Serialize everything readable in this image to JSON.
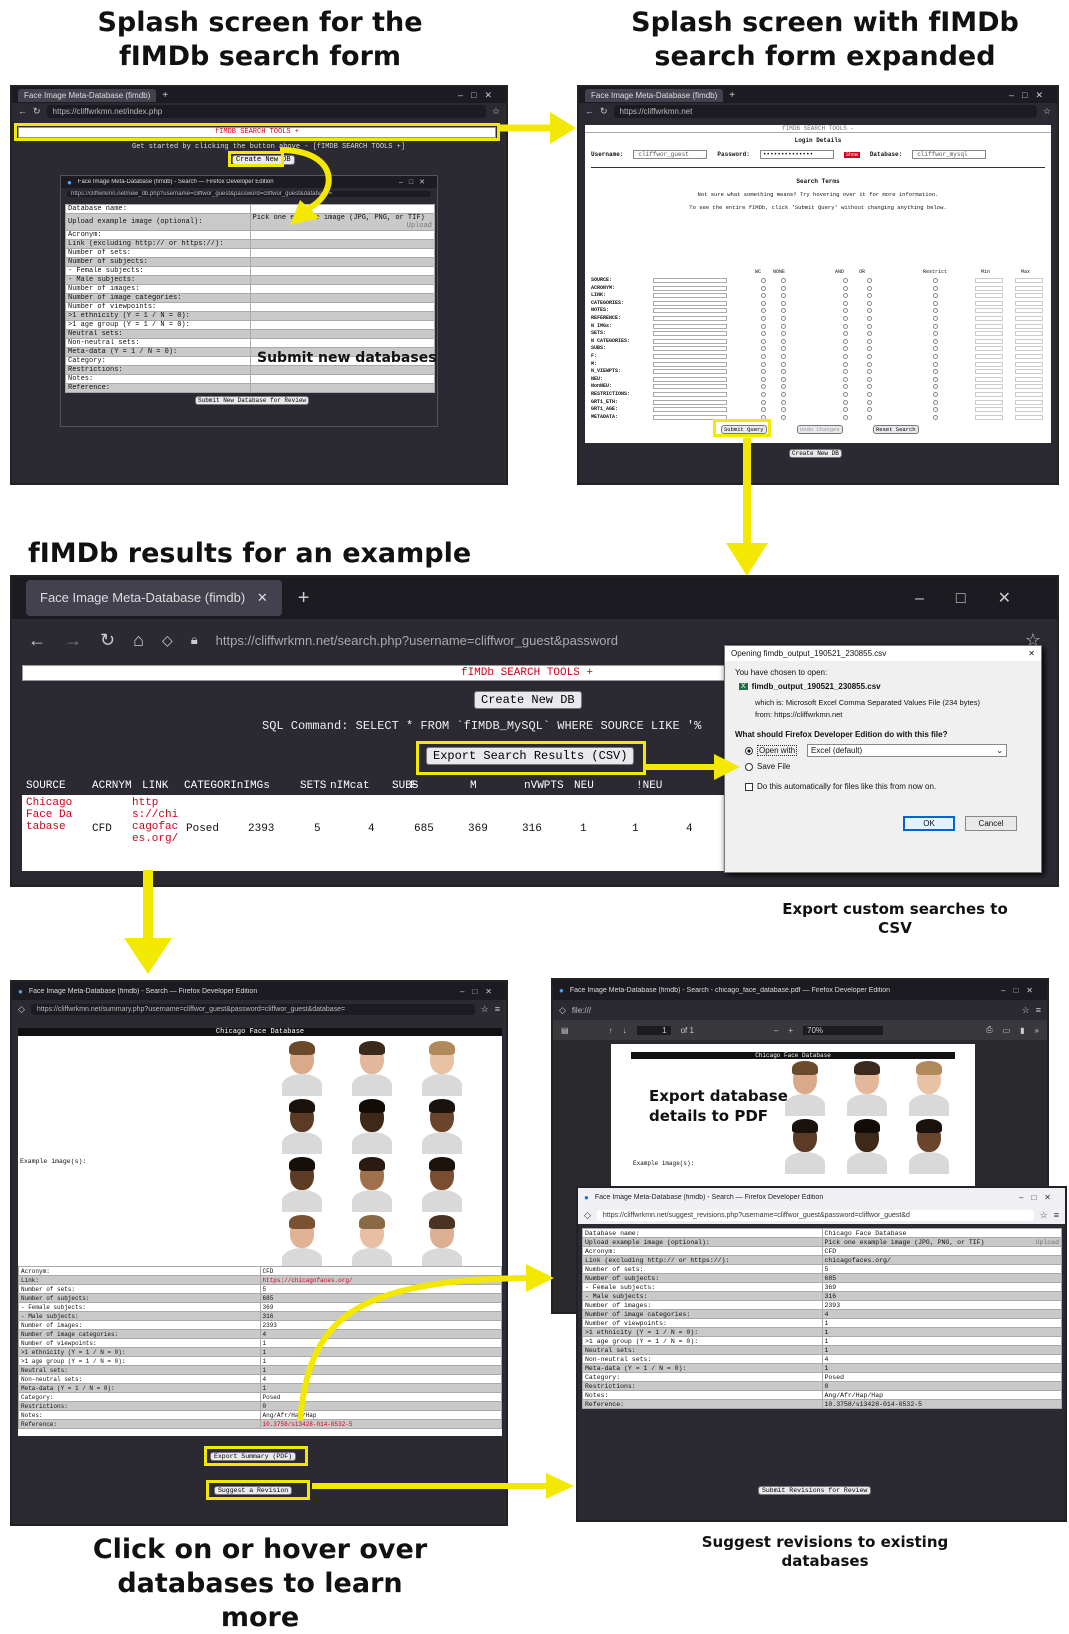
{
  "captions": {
    "top_left": "Splash screen for the fIMDb search form",
    "top_right": "Splash screen with fIMDb search form expanded",
    "middle": "fIMDb results for an example query",
    "export_csv": "Export custom searches to CSV",
    "bottom_left": "Click on or hover over databases to learn more",
    "bottom_right": "Suggest revisions to existing databases"
  },
  "shot1": {
    "tab": "Face Image Meta-Database (fimdb)",
    "url": "https://cliffwrkmn.net/index.php",
    "tools": "fIMDB SEARCH TOOLS +",
    "getting_started": "Get started by clicking the button above - [fIMDB SEARCH TOOLS +]",
    "create_btn": "Create New DB",
    "popup_title": "Face Image Meta-Database (fimdb) - Search — Firefox Developer Edition",
    "popup_url": "https://cliffwrkmn.net/new_db.php?username=cliffwor_guest&password=cliffwor_guest&database=",
    "form_rows": [
      "Database name:",
      "Upload example image (optional):",
      "Acronym:",
      "Link (excluding http:// or https://):",
      "Number of sets:",
      "Number of subjects:",
      "- Female subjects:",
      "- Male subjects:",
      "Number of images:",
      "Number of image categories:",
      "Number of viewpoints:",
      ">1 ethnicity (Y = 1 / N = 0):",
      ">1 age group (Y = 1 / N = 0):",
      "Neutral sets:",
      "Non-neutral sets:",
      "Meta-data (Y = 1 / N = 0):",
      "Category:",
      "Restrictions:",
      "Notes:",
      "Reference:"
    ],
    "pick_label": "Pick one example image (JPG, PNG, or TIF)",
    "upload_label": "Upload",
    "submit_new_label": "Submit new databases",
    "submit_btn": "Submit New Database for Review"
  },
  "shot2": {
    "tab": "Face Image Meta-Database (fimdb)",
    "url": "https://cliffwrkmn.net",
    "tools": "fIMDB SEARCH TOOLS -",
    "login_title": "Login Details",
    "username_label": "Username:",
    "username_value": "cliffwor_guest",
    "password_label": "Password:",
    "password_value": "••••••••••••••",
    "show_label": "Show",
    "database_label": "Database:",
    "database_value": "cliffwor_mysql",
    "search_terms": "Search Terms",
    "hint1": "Not sure what something means? Try hovering over it for more information.",
    "hint2": "To see the entire fIMDb, click 'Submit Query' without changing anything below.",
    "col_heads": [
      "WC",
      "NONE",
      "AND",
      "OR",
      "Restrict",
      "Min",
      "Max"
    ],
    "fields": [
      "SOURCE:",
      "ACRONYM:",
      "LINK:",
      "CATEGORIES:",
      "NOTES:",
      "REFERENCE:",
      "N IMGs:",
      "SETS:",
      "N CATEGORIES:",
      "SUBS:",
      "F:",
      "M:",
      "N_VIEWPTS:",
      "NEU:",
      "NonNEU:",
      "RESTRICTIONS:",
      "GRT1_ETH:",
      "GRT1_AGE:",
      "METADATA:"
    ],
    "submit_query": "Submit Query",
    "undo": "Undo Changes",
    "reset": "Reset Search",
    "create_btn": "Create New DB"
  },
  "shot3": {
    "tab": "Face Image Meta-Database (fimdb)",
    "url_domain": "https://cliffwrkmn.net",
    "url_rest": "/search.php?username=cliffwor_guest&password",
    "tools": "fIMDb SEARCH TOOLS +",
    "create_btn": "Create New DB",
    "sql": "SQL Command: SELECT * FROM `fIMDB_MySQL` WHERE SOURCE LIKE '%",
    "export_btn": "Export Search Results (CSV)",
    "headers": [
      "SOURCE",
      "ACRNYM",
      "LINK",
      "CATEGORInIMGs",
      "SETS",
      "nIMcat",
      "SUBS",
      "F",
      "M",
      "nVWPTS",
      "NEU",
      "!NEU"
    ],
    "row": {
      "source": "Chicago Face Database",
      "acronym": "CFD",
      "link": "https://chicagofaces.org/",
      "category": "Posed",
      "imgs": "2393",
      "sets": "5",
      "imcat": "4",
      "subs": "685",
      "f": "369",
      "m": "316",
      "vwpts": "1",
      "neu": "1",
      "notneu": "4"
    },
    "dialog": {
      "title": "Opening fimdb_output_190521_230855.csv",
      "chosen": "You have chosen to open:",
      "filename": "fimdb_output_190521_230855.csv",
      "which_is": "which is: Microsoft Excel Comma Separated Values File (234 bytes)",
      "from": "from: https://cliffwrkmn.net",
      "question": "What should Firefox Developer Edition do with this file?",
      "open_with": "Open with",
      "open_with_app": "Excel (default)",
      "save_file": "Save File",
      "auto": "Do this automatically for files like this from now on.",
      "ok": "OK",
      "cancel": "Cancel"
    }
  },
  "shot4": {
    "title": "Face Image Meta-Database (fimdb) - Search — Firefox Developer Edition",
    "url": "https://cliffwrkmn.net/summary.php?username=cliffwor_guest&password=cliffwor_guest&database=",
    "db_title": "Chicago Face Database",
    "example_label": "Example image(s):",
    "rows": [
      [
        "Acronym:",
        "CFD"
      ],
      [
        "Link:",
        "https://chicagofaces.org/"
      ],
      [
        "Number of sets:",
        "5"
      ],
      [
        "Number of subjects:",
        "685"
      ],
      [
        "- Female subjects:",
        "369"
      ],
      [
        "- Male subjects:",
        "316"
      ],
      [
        "Number of images:",
        "2393"
      ],
      [
        "Number of image categories:",
        "4"
      ],
      [
        "Number of viewpoints:",
        "1"
      ],
      [
        ">1 ethnicity (Y = 1 / N = 0):",
        "1"
      ],
      [
        ">1 age group (Y = 1 / N = 0):",
        "1"
      ],
      [
        "Neutral sets:",
        "1"
      ],
      [
        "Non-neutral sets:",
        "4"
      ],
      [
        "Meta-data (Y = 1 / N = 0):",
        "1"
      ],
      [
        "Category:",
        "Posed"
      ],
      [
        "Restrictions:",
        "0"
      ],
      [
        "Notes:",
        "Ang/Afr/Hap/Hap"
      ],
      [
        "Reference:",
        "10.3758/s13428-014-0532-5"
      ]
    ],
    "export_pdf": "Export Summary (PDF)",
    "suggest": "Suggest a Revision"
  },
  "shot5": {
    "title": "Face Image Meta-Database (fimdb) - Search - chicago_face_database.pdf — Firefox Developer Edition",
    "url": "file:///",
    "page_num": "1",
    "page_of": "of 1",
    "zoom": "70%",
    "pdf_title": "Chicago Face Database",
    "pdf_label": "Export database details to PDF",
    "pdf_example": "Example image(s):"
  },
  "shot6": {
    "title": "Face Image Meta-Database (fimdb) - Search — Firefox Developer Edition",
    "url": "https://cliffwrkmn.net/suggest_revisions.php?username=cliffwor_guest&password=cliffwor_guest&d",
    "rows": [
      [
        "Database name:",
        "Chicago Face Database"
      ],
      [
        "Upload example image (optional):",
        "Pick one example image (JPG, PNG, or TIF)"
      ],
      [
        "Acronym:",
        "CFD"
      ],
      [
        "Link (excluding http:// or https://):",
        "chicagofaces.org/"
      ],
      [
        "Number of sets:",
        "5"
      ],
      [
        "Number of subjects:",
        "685"
      ],
      [
        "- Female subjects:",
        "369"
      ],
      [
        "- Male subjects:",
        "316"
      ],
      [
        "Number of images:",
        "2393"
      ],
      [
        "Number of image categories:",
        "4"
      ],
      [
        "Number of viewpoints:",
        "1"
      ],
      [
        ">1 ethnicity (Y = 1 / N = 0):",
        "1"
      ],
      [
        ">1 age group (Y = 1 / N = 0):",
        "1"
      ],
      [
        "Neutral sets:",
        "1"
      ],
      [
        "Non-neutral sets:",
        "4"
      ],
      [
        "Meta-data (Y = 1 / N = 0):",
        "1"
      ],
      [
        "Category:",
        "Posed"
      ],
      [
        "Restrictions:",
        "0"
      ],
      [
        "Notes:",
        "Ang/Afr/Hap/Hap"
      ],
      [
        "Reference:",
        "10.3758/s13428-014-0532-5"
      ]
    ],
    "upload": "Upload",
    "submit": "Submit Revisions for Review"
  },
  "colors": {
    "highlight": "#f2e800",
    "link_red": "#d1001f",
    "browser_dark": "#2b2a33"
  }
}
